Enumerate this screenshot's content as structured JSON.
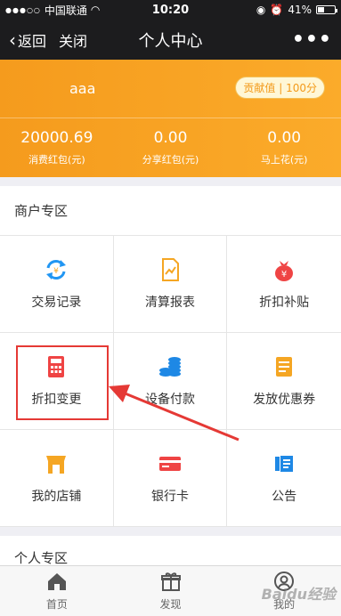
{
  "status": {
    "carrier": "中国联通",
    "time": "10:20",
    "battery": "41%"
  },
  "nav": {
    "back": "返回",
    "close": "关闭",
    "title": "个人中心",
    "more": "•••"
  },
  "profile": {
    "name": "aaa",
    "contrib": "贡献值 | 100分"
  },
  "stats": [
    {
      "value": "20000.69",
      "label": "消费红包(元)"
    },
    {
      "value": "0.00",
      "label": "分享红包(元)"
    },
    {
      "value": "0.00",
      "label": "马上花(元)"
    }
  ],
  "merchant": {
    "title": "商户专区",
    "items": [
      {
        "label": "交易记录",
        "icon": "exchange-icon",
        "color": "#2196f3"
      },
      {
        "label": "清算报表",
        "icon": "report-icon",
        "color": "#f5a623"
      },
      {
        "label": "折扣补贴",
        "icon": "money-bag-icon",
        "color": "#ef4444"
      },
      {
        "label": "折扣变更",
        "icon": "calculator-icon",
        "color": "#ef4444"
      },
      {
        "label": "设备付款",
        "icon": "coins-icon",
        "color": "#1e88e5"
      },
      {
        "label": "发放优惠券",
        "icon": "coupon-icon",
        "color": "#f5a623"
      },
      {
        "label": "我的店铺",
        "icon": "store-icon",
        "color": "#f5a623"
      },
      {
        "label": "银行卡",
        "icon": "card-icon",
        "color": "#ef4444"
      },
      {
        "label": "公告",
        "icon": "notice-icon",
        "color": "#1e88e5"
      }
    ]
  },
  "personal": {
    "title": "个人专区"
  },
  "tabs": [
    {
      "label": "首页",
      "icon": "home-icon"
    },
    {
      "label": "发现",
      "icon": "gift-icon"
    },
    {
      "label": "我的",
      "icon": "user-icon"
    }
  ],
  "watermark": "Baidu经验"
}
